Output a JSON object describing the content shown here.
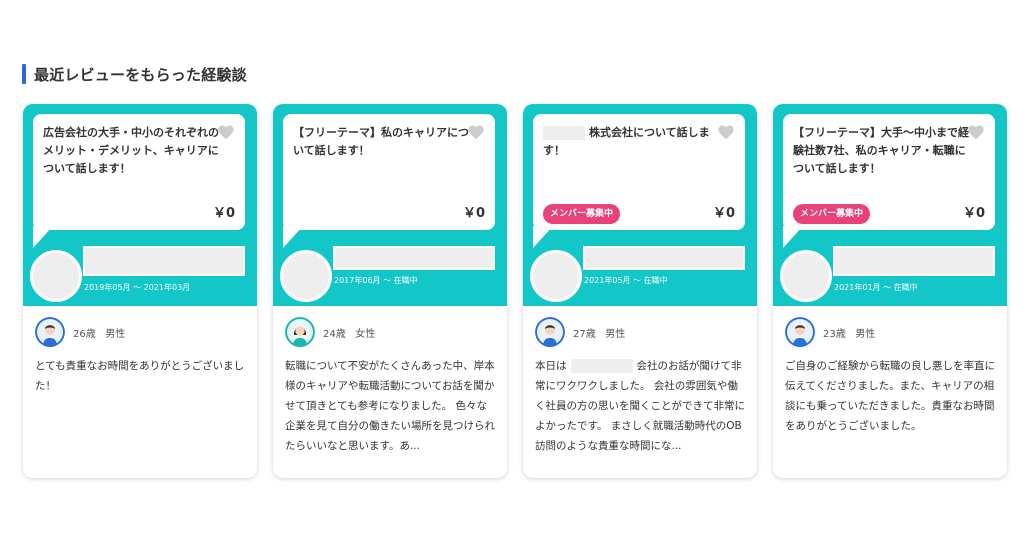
{
  "section": {
    "title": "最近レビューをもらった経験談"
  },
  "colors": {
    "accent": "#13c6c8",
    "badge": "#e8427c",
    "title_bar": "#2b67d9"
  },
  "cards": [
    {
      "title": "広告会社の大手・中小のそれぞれのメリット・デメリット、キャリアについて話します！",
      "price": "￥0",
      "period": "2019年05月 〜 2021年03月",
      "reviewer": {
        "age": "26歳",
        "gender": "男性",
        "avatar": "male-avatar"
      },
      "review": "とても貴重なお時間をありがとうございました！"
    },
    {
      "title": "【フリーテーマ】私のキャリアについて話します！",
      "price": "￥0",
      "period": "2017年06月 〜 在職中",
      "reviewer": {
        "age": "24歳",
        "gender": "女性",
        "avatar": "female-avatar"
      },
      "review": "転職について不安がたくさんあった中、岸本様のキャリアや転職活動についてお話を聞かせて頂きとても参考になりました。 色々な企業を見て自分の働きたい場所を見つけられたらいいなと思います。あ..."
    },
    {
      "title_suffix": "株式会社について話します！",
      "badge": "メンバー募集中",
      "price": "￥0",
      "period": "2021年05月 〜 在職中",
      "reviewer": {
        "age": "27歳",
        "gender": "男性",
        "avatar": "male-avatar"
      },
      "review_prefix": "本日は",
      "review_suffix": "会社のお話が聞けて非常にワクワクしました。 会社の雰囲気や働く社員の方の思いを聞くことができて非常によかったです。 まさしく就職活動時代のOB訪問のような貴重な時間にな..."
    },
    {
      "title": "【フリーテーマ】大手〜中小まで経験社数7社、私のキャリア・転職について話します！",
      "badge": "メンバー募集中",
      "price": "￥0",
      "period": "2021年01月 〜 在職中",
      "reviewer": {
        "age": "23歳",
        "gender": "男性",
        "avatar": "male-avatar"
      },
      "review": "ご自身のご経験から転職の良し悪しを率直に伝えてくださりました。また、キャリアの相談にも乗っていただきました。貴重なお時間をありがとうございました。"
    }
  ]
}
